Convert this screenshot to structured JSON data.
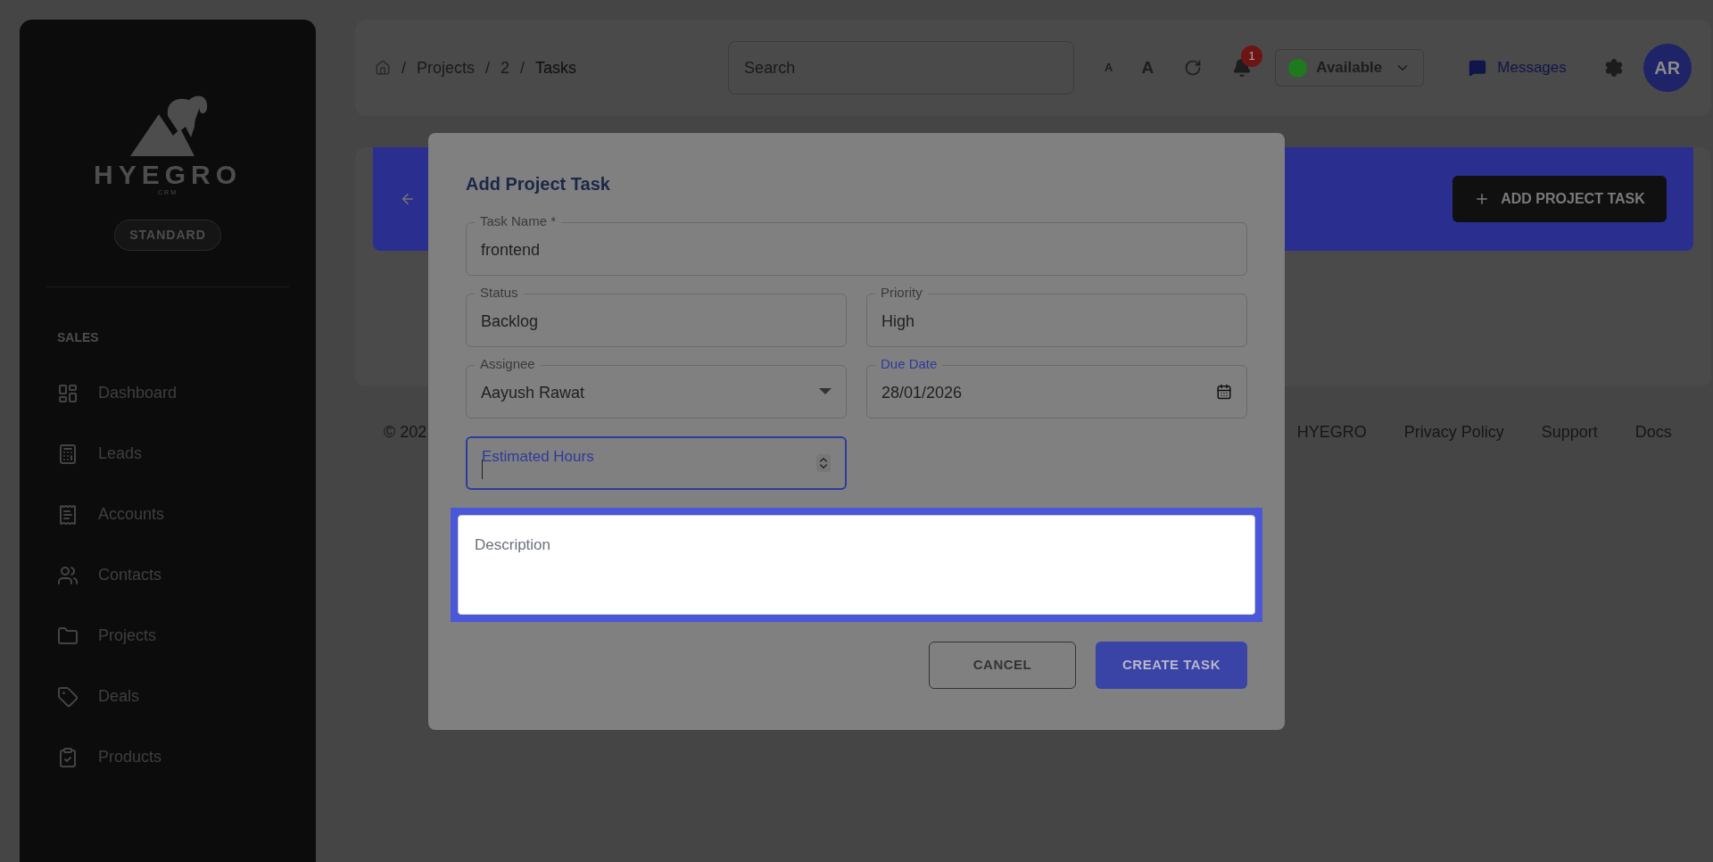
{
  "sidebar": {
    "brand": "HYEGRO",
    "brand_sub": "CRM",
    "plan_badge": "STANDARD",
    "section": "SALES",
    "items": [
      {
        "label": "Dashboard",
        "selected": false
      },
      {
        "label": "Leads",
        "selected": false
      },
      {
        "label": "Accounts",
        "selected": false
      },
      {
        "label": "Contacts",
        "selected": false
      },
      {
        "label": "Projects",
        "selected": false
      },
      {
        "label": "Deals",
        "selected": false
      },
      {
        "label": "Products",
        "selected": false
      }
    ]
  },
  "topbar": {
    "breadcrumb_separator": "/",
    "breadcrumb": [
      "Projects",
      "2",
      "Tasks"
    ],
    "search": {
      "placeholder": "Search"
    },
    "font_small": "A",
    "font_large": "A",
    "notifications": "1",
    "status": {
      "label": "Available",
      "color": "#1e7a1e"
    },
    "messages": "Messages",
    "avatar": "AR"
  },
  "header": {
    "button": "ADD PROJECT TASK"
  },
  "footer": {
    "copyright": "© 202",
    "links": [
      "HYEGRO",
      "Privacy Policy",
      "Support",
      "Docs"
    ]
  },
  "dialog": {
    "title": "Add Project Task",
    "rows": [
      [
        {
          "kind": "text",
          "label": "Task Name *",
          "value": "frontend",
          "focused": false
        }
      ],
      [
        {
          "kind": "text",
          "label": "Status",
          "value": "Backlog",
          "focused": false
        },
        {
          "kind": "text",
          "label": "Priority",
          "value": "High",
          "focused": false
        }
      ],
      [
        {
          "kind": "select",
          "label": "Assignee",
          "value": "Aayush Rawat",
          "focused": false
        },
        {
          "kind": "date",
          "label": "Due Date",
          "value": "28/01/2026",
          "focused": false
        }
      ],
      [
        {
          "kind": "number",
          "label": "Estimated Hours",
          "focused": true
        }
      ],
      [
        {
          "kind": "textarea",
          "placeholder": "Description",
          "highlighted": true
        }
      ]
    ],
    "buttons": [
      {
        "label": "CANCEL",
        "kind": "outline"
      },
      {
        "label": "CREATE TASK",
        "kind": "primary"
      }
    ]
  }
}
